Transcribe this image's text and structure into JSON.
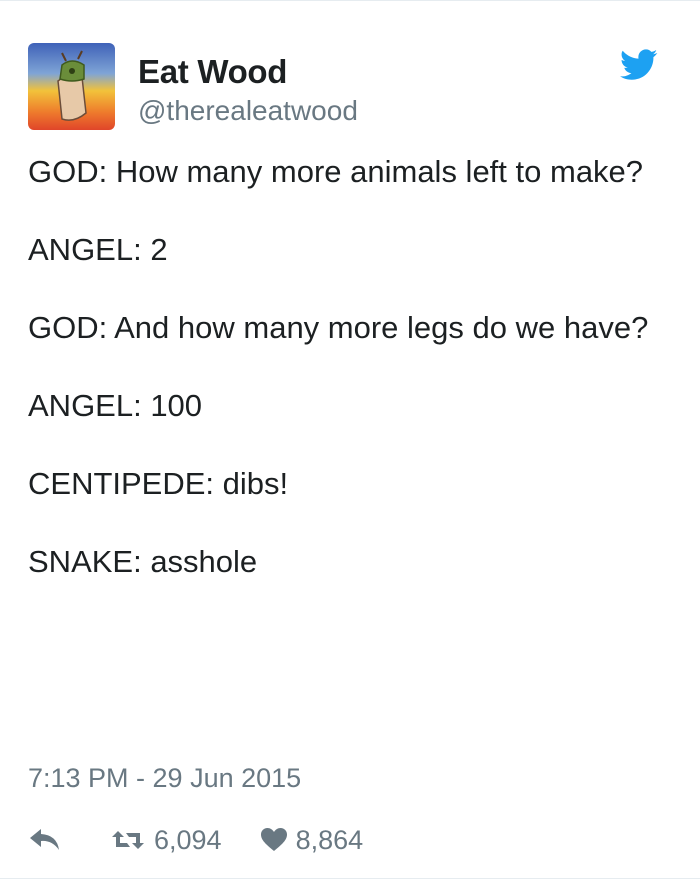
{
  "author": {
    "display_name": "Eat Wood",
    "handle": "@therealeatwood",
    "avatar_icon": "avatar-image"
  },
  "brand_icon": "twitter-bird-icon",
  "tweet": {
    "lines": [
      "GOD: How many more animals left to make?",
      "ANGEL: 2",
      "GOD: And how many more legs do we have?",
      "ANGEL: 100",
      "CENTIPEDE: dibs!",
      "SNAKE: asshole"
    ],
    "timestamp": "7:13 PM - 29 Jun 2015"
  },
  "actions": {
    "retweet_count": "6,094",
    "like_count": "8,864"
  },
  "colors": {
    "brand_blue": "#1da1f2",
    "text": "#1c2022",
    "muted": "#697882"
  }
}
